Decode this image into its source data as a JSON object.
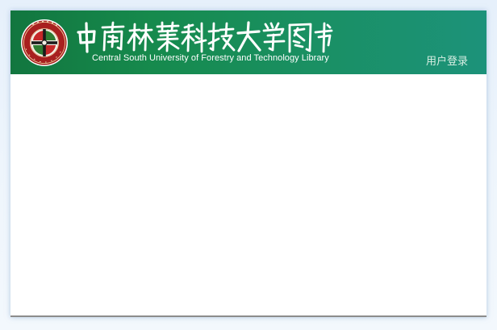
{
  "header": {
    "logo_icon": "university-seal-icon",
    "seal_text": "中南林业科技大学",
    "title_cn": "中南林业科技大学图书馆",
    "title_en": "Central South University of Forestry and Technology Library",
    "login_label": "用户登录"
  },
  "colors": {
    "header_start": "#12763f",
    "header_end": "#1c927a",
    "seal_red": "#b01e23",
    "seal_green": "#2e7d32",
    "text_white": "#ffffff"
  }
}
